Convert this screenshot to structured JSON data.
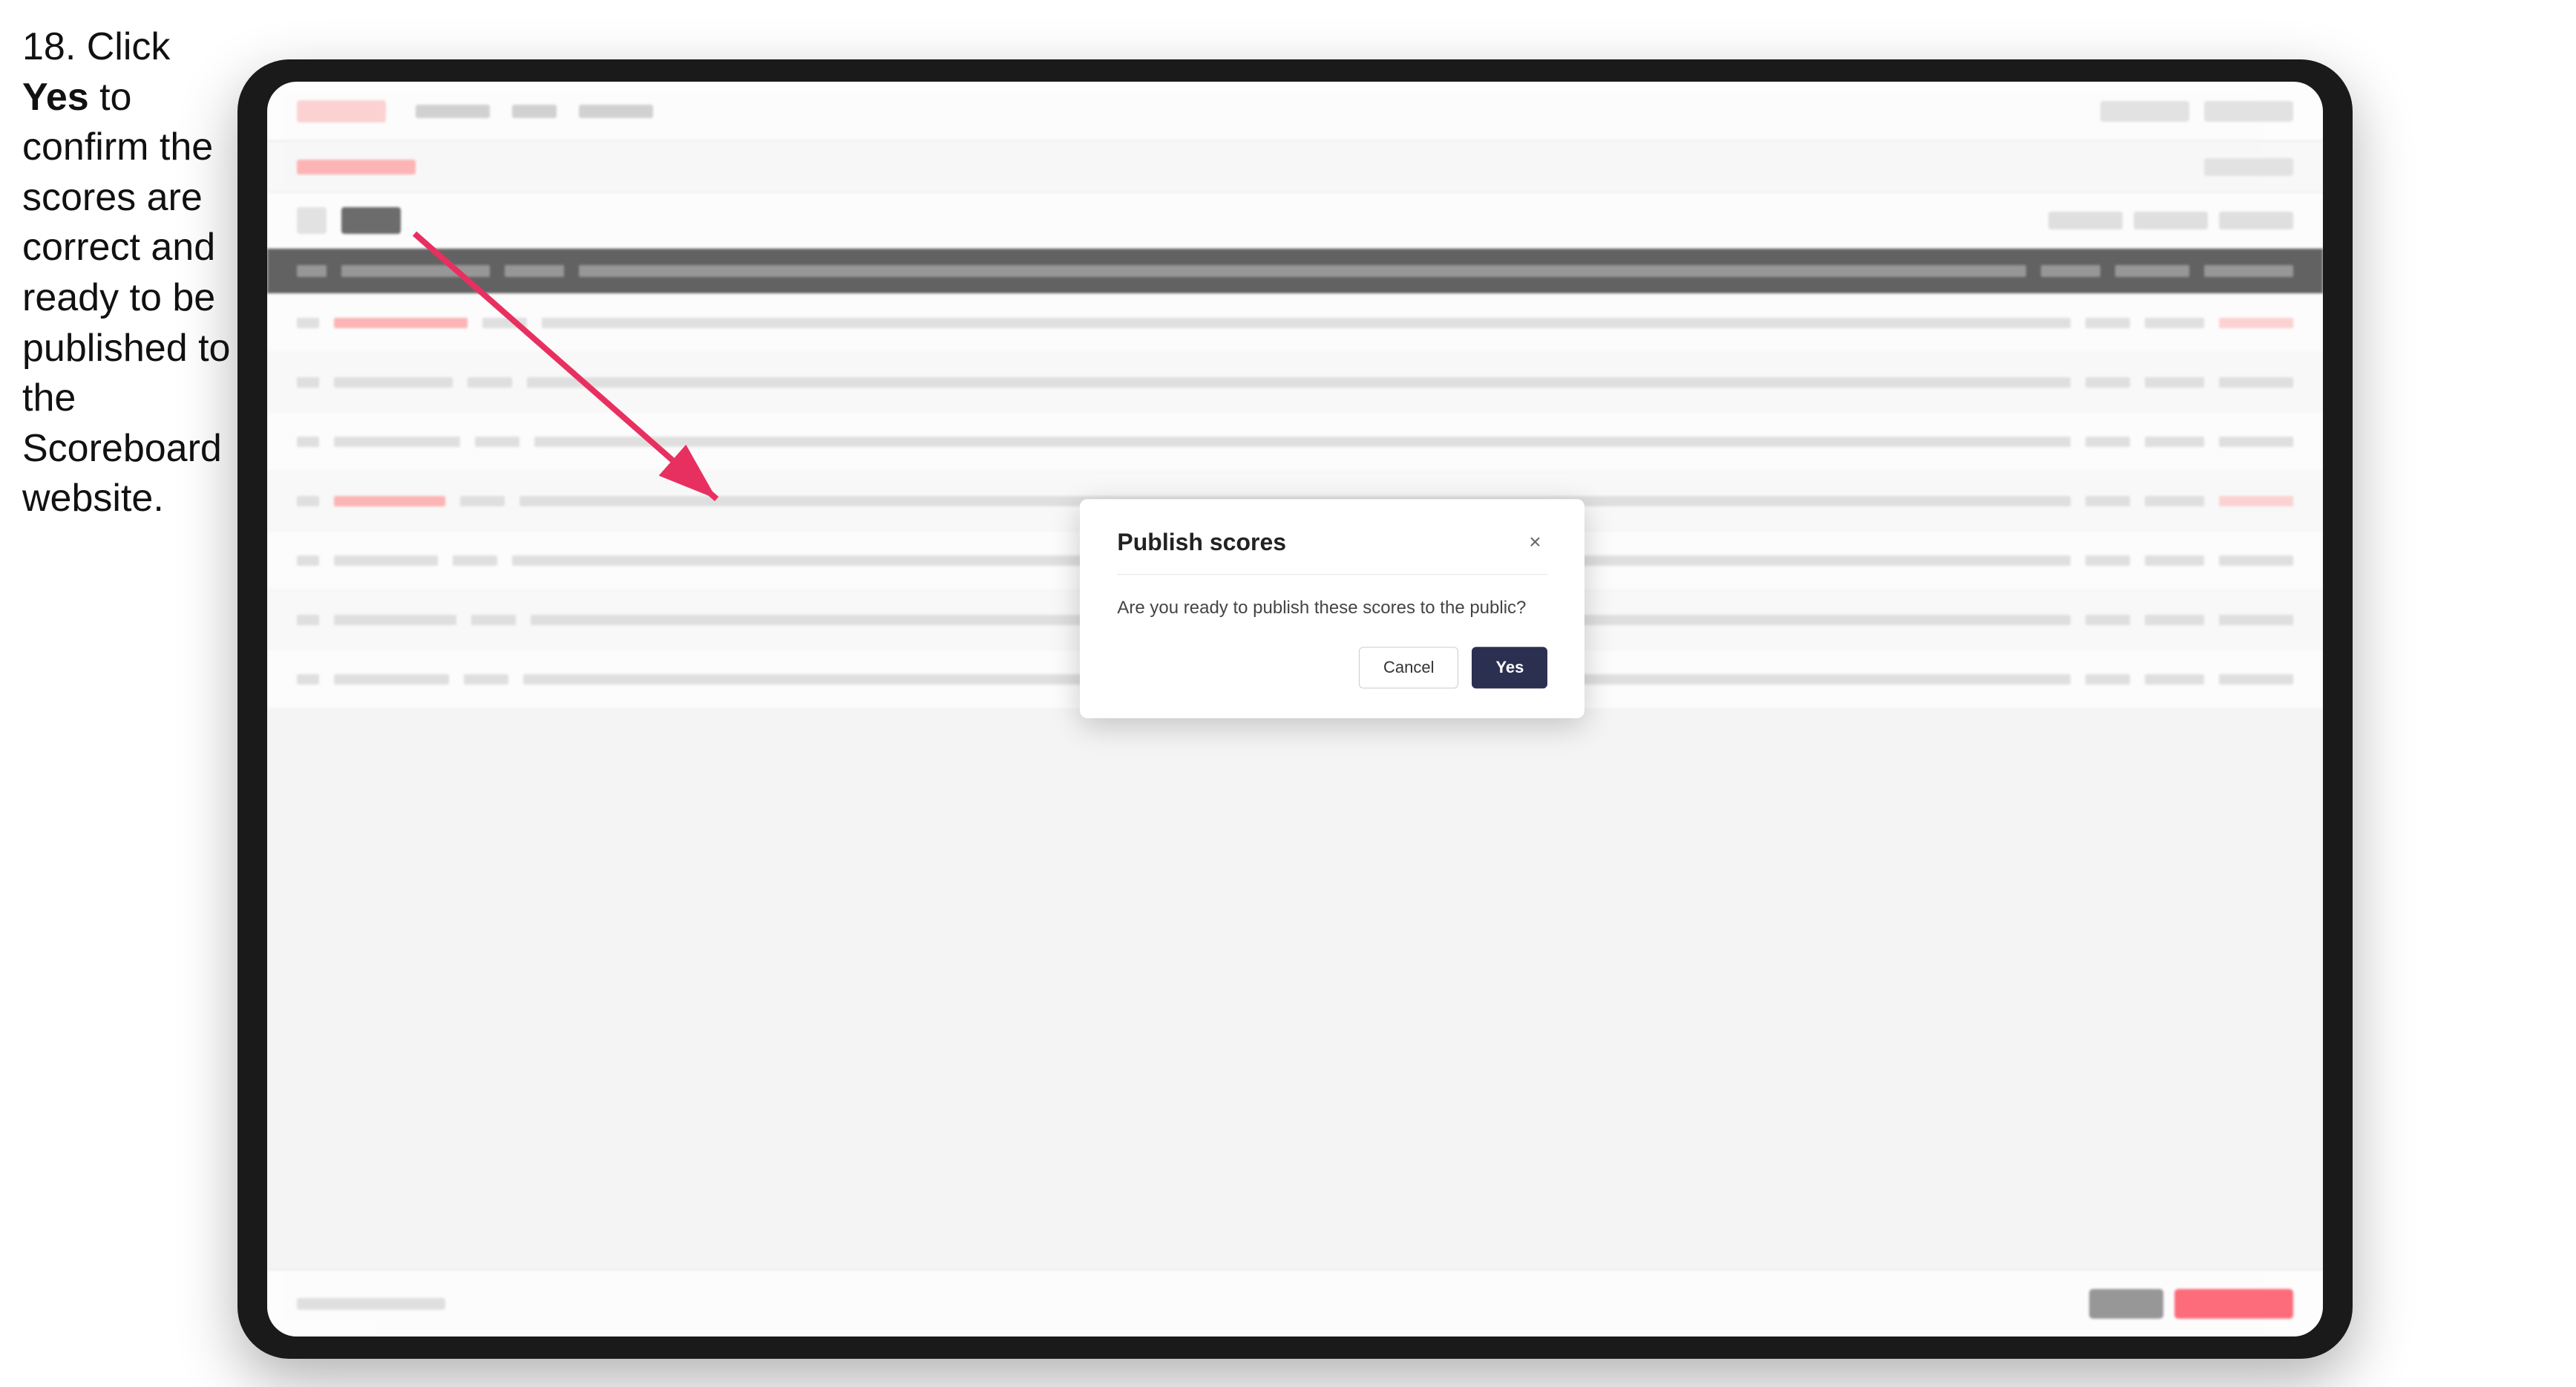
{
  "instruction": {
    "step_number": "18.",
    "text_line1": " Click ",
    "bold_word": "Yes",
    "text_line2": " to confirm the scores are correct and ready to be published to the Scoreboard website."
  },
  "dialog": {
    "title": "Publish scores",
    "message": "Are you ready to publish these scores to the public?",
    "cancel_label": "Cancel",
    "yes_label": "Yes",
    "close_icon": "×"
  },
  "colors": {
    "yes_button_bg": "#2c3050",
    "cancel_button_border": "#cccccc",
    "arrow_color": "#e83060"
  }
}
